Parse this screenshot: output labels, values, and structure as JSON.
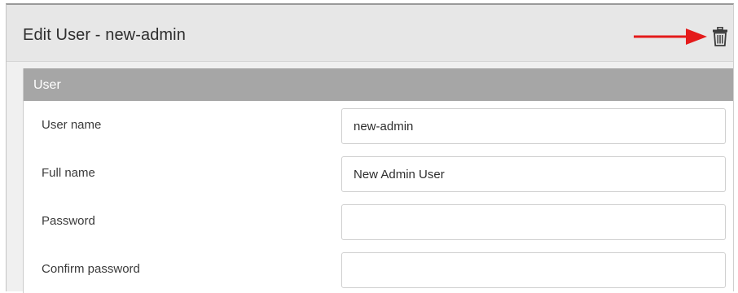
{
  "dialog": {
    "title": "Edit User - new-admin",
    "delete_icon": "trash-icon",
    "arrow_color": "#e41b1b"
  },
  "section": {
    "title": "User"
  },
  "fields": [
    {
      "label": "User name",
      "value": "new-admin",
      "type": "text"
    },
    {
      "label": "Full name",
      "value": "New Admin User",
      "type": "text"
    },
    {
      "label": "Password",
      "value": "",
      "type": "password"
    },
    {
      "label": "Confirm password",
      "value": "",
      "type": "password"
    }
  ]
}
